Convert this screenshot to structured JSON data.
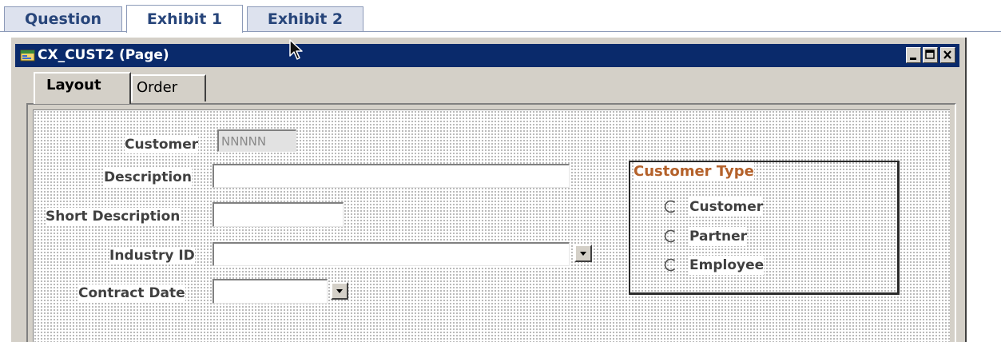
{
  "exhibit_tabs": [
    {
      "label": "Question",
      "active": false
    },
    {
      "label": "Exhibit 1",
      "active": true
    },
    {
      "label": "Exhibit 2",
      "active": false
    }
  ],
  "window": {
    "title": "CX_CUST2 (Page)"
  },
  "page_tabs": [
    {
      "label": "Layout",
      "active": true
    },
    {
      "label": "Order",
      "active": false
    }
  ],
  "form": {
    "customer": {
      "label": "Customer",
      "value": "NNNNN"
    },
    "description": {
      "label": "Description",
      "value": ""
    },
    "short_description": {
      "label": "Short Description",
      "value": ""
    },
    "industry_id": {
      "label": "Industry ID",
      "value": ""
    },
    "contract_date": {
      "label": "Contract Date",
      "value": ""
    }
  },
  "customer_type": {
    "title": "Customer Type",
    "options": [
      "Customer",
      "Partner",
      "Employee"
    ]
  },
  "colors": {
    "title_bar": "#0a2a6b",
    "exhibit_tab_text": "#27457a",
    "group_title": "#b4612a",
    "window_face": "#d4d0c8"
  },
  "icons": {
    "window_icon": "page-icon",
    "minimize": "minimize-icon",
    "maximize": "maximize-icon",
    "close": "close-icon",
    "prompt": "prompt-arrow-icon",
    "cursor": "mouse-cursor-icon"
  }
}
